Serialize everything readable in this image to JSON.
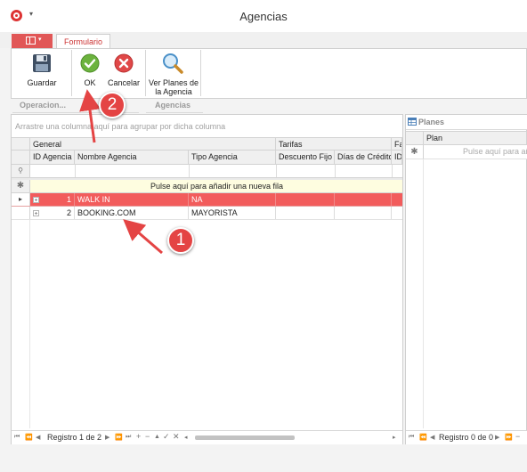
{
  "window": {
    "title": "Agencias"
  },
  "ribbon": {
    "tab_formulario": "Formulario",
    "buttons": {
      "guardar": "Guardar",
      "ok": "OK",
      "cancelar": "Cancelar",
      "ver_planes_line1": "Ver Planes de",
      "ver_planes_line2": "la Agencia"
    },
    "groups": {
      "operaciones": "Operacion...",
      "agencias": "Agencias"
    }
  },
  "grid": {
    "group_by_hint": "Arrastre una columna aquí para agrupar por dicha columna",
    "bands": {
      "general": "General",
      "tarifas": "Tarifas",
      "fa": "Fa"
    },
    "columns": {
      "id_agencia": "ID Agencia",
      "nombre_agencia": "Nombre Agencia",
      "tipo_agencia": "Tipo Agencia",
      "descuento_fijo": "Descuento Fijo",
      "dias_credito": "Días de Crédito",
      "id_extra": "ID"
    },
    "new_row_hint": "Pulse aquí para añadir una nueva fila",
    "rows": [
      {
        "id": "1",
        "nombre": "WALK IN",
        "tipo": "NA",
        "selected": true
      },
      {
        "id": "2",
        "nombre": "BOOKING.COM",
        "tipo": "MAYORISTA",
        "selected": false
      }
    ],
    "navigator": {
      "record_text": "Registro 1 de 2"
    },
    "colors": {
      "selected_row": "#f25c5c",
      "new_row_bg": "#fefde0",
      "accent": "#e15757"
    }
  },
  "planes": {
    "title": "Planes",
    "column_plan": "Plan",
    "new_row_hint": "Pulse aquí para añadir",
    "navigator": {
      "record_text": "Registro 0 de 0"
    }
  },
  "annotations": {
    "badge_1": "1",
    "badge_2": "2"
  }
}
